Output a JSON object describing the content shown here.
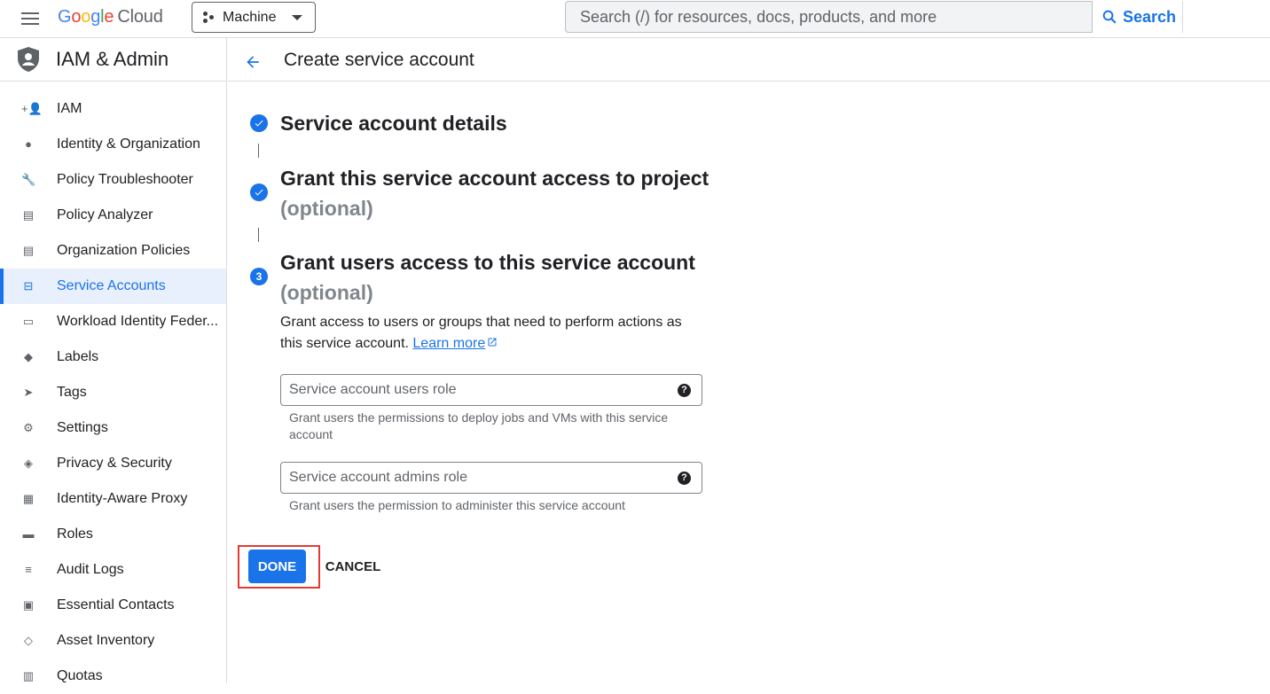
{
  "topbar": {
    "logo_google": [
      "G",
      "o",
      "o",
      "g",
      "l",
      "e"
    ],
    "logo_cloud": "Cloud",
    "project": "Machine",
    "search_placeholder": "Search (/) for resources, docs, products, and more",
    "search_button": "Search"
  },
  "sidebar": {
    "title": "IAM & Admin",
    "items": [
      {
        "label": "IAM",
        "icon": "person-add-icon",
        "glyph": "+👤"
      },
      {
        "label": "Identity & Organization",
        "icon": "account-circle-icon",
        "glyph": "●"
      },
      {
        "label": "Policy Troubleshooter",
        "icon": "wrench-icon",
        "glyph": "🔧"
      },
      {
        "label": "Policy Analyzer",
        "icon": "document-search-icon",
        "glyph": "▤"
      },
      {
        "label": "Organization Policies",
        "icon": "list-doc-icon",
        "glyph": "▤"
      },
      {
        "label": "Service Accounts",
        "icon": "service-account-icon",
        "glyph": "⊟",
        "active": true
      },
      {
        "label": "Workload Identity Feder...",
        "icon": "id-card-icon",
        "glyph": "▭"
      },
      {
        "label": "Labels",
        "icon": "label-icon",
        "glyph": "◆"
      },
      {
        "label": "Tags",
        "icon": "tag-icon",
        "glyph": "➤"
      },
      {
        "label": "Settings",
        "icon": "gear-icon",
        "glyph": "⚙"
      },
      {
        "label": "Privacy & Security",
        "icon": "shield-icon",
        "glyph": "◈"
      },
      {
        "label": "Identity-Aware Proxy",
        "icon": "proxy-icon",
        "glyph": "▦"
      },
      {
        "label": "Roles",
        "icon": "roles-icon",
        "glyph": "▬"
      },
      {
        "label": "Audit Logs",
        "icon": "list-icon",
        "glyph": "≡"
      },
      {
        "label": "Essential Contacts",
        "icon": "contact-icon",
        "glyph": "▣"
      },
      {
        "label": "Asset Inventory",
        "icon": "inventory-icon",
        "glyph": "◇"
      },
      {
        "label": "Quotas",
        "icon": "quota-icon",
        "glyph": "▥"
      }
    ]
  },
  "page": {
    "title": "Create service account",
    "steps": [
      {
        "title": "Service account details",
        "state": "complete"
      },
      {
        "title": "Grant this service account access to project",
        "optional": "(optional)",
        "state": "complete"
      },
      {
        "title": "Grant users access to this service account",
        "optional": "(optional)",
        "state": "active",
        "number": "3"
      }
    ],
    "description": "Grant access to users or groups that need to perform actions as this service account.",
    "learn_more": "Learn more",
    "fields": [
      {
        "placeholder": "Service account users role",
        "hint": "Grant users the permissions to deploy jobs and VMs with this service account"
      },
      {
        "placeholder": "Service account admins role",
        "hint": "Grant users the permission to administer this service account"
      }
    ],
    "help_glyph": "?",
    "done": "DONE",
    "cancel": "CANCEL"
  }
}
